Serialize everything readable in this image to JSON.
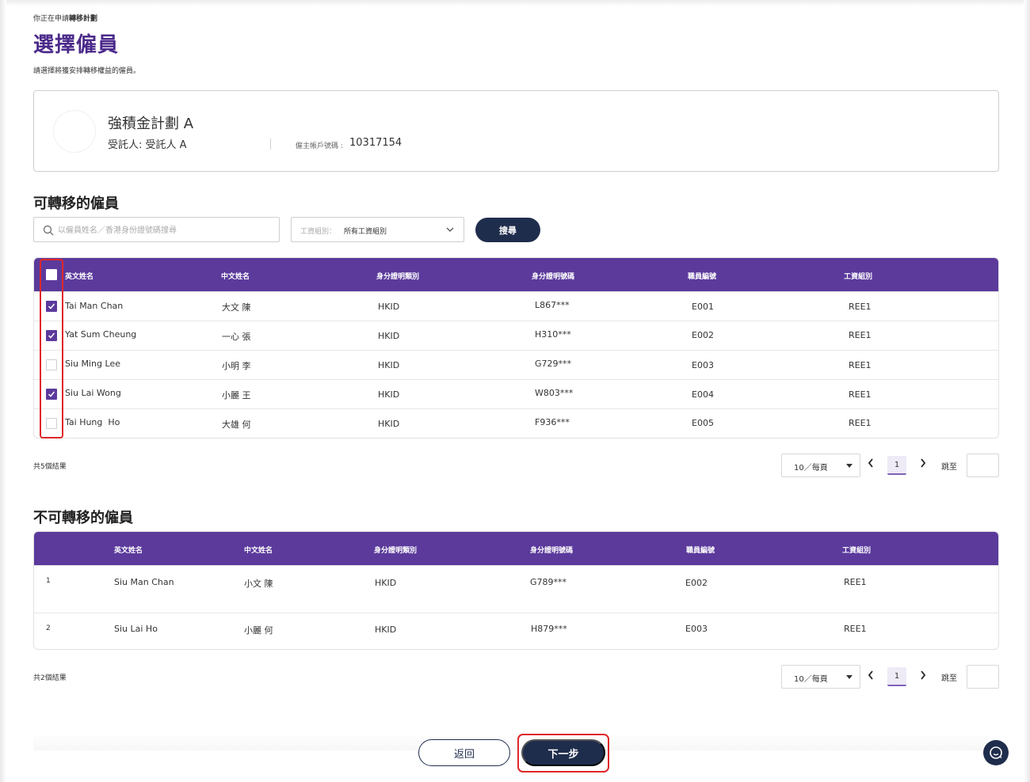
{
  "breadcrumb": {
    "prefix": "你正在申請",
    "highlight": "轉移計劃"
  },
  "page": {
    "title": "選擇僱員",
    "subtitle": "請選擇將獲安排轉移權益的僱員。"
  },
  "plan": {
    "name": "強積金計劃 A",
    "trustee": "受託人: 受託人 A",
    "account_label": "僱主帳戶號碼 :",
    "account_value": "10317154"
  },
  "transferable": {
    "section_title": "可轉移的僱員",
    "search_placeholder": "以僱員姓名／香港身份證號碼搜尋",
    "payroll_label": "工資組別：",
    "payroll_value": "所有工資組別",
    "search_button": "搜尋",
    "columns": [
      "英文姓名",
      "中文姓名",
      "身分證明類別",
      "身分證明號碼",
      "職員編號",
      "工資組別"
    ],
    "rows": [
      {
        "checked": true,
        "en": "Tai Man Chan",
        "zh": "大文 陳",
        "id_type": "HKID",
        "id_no": "L867***",
        "staff": "E001",
        "group": "REE1"
      },
      {
        "checked": true,
        "en": "Yat Sum Cheung",
        "zh": "一心 張",
        "id_type": "HKID",
        "id_no": "H310***",
        "staff": "E002",
        "group": "REE1"
      },
      {
        "checked": false,
        "en": "Siu Ming Lee",
        "zh": "小明 李",
        "id_type": "HKID",
        "id_no": "G729***",
        "staff": "E003",
        "group": "REE1"
      },
      {
        "checked": true,
        "en": "Siu Lai Wong",
        "zh": "小麗 王",
        "id_type": "HKID",
        "id_no": "W803***",
        "staff": "E004",
        "group": "REE1"
      },
      {
        "checked": false,
        "en": "Tai Hung  Ho",
        "zh": "大雄 何",
        "id_type": "HKID",
        "id_no": "F936***",
        "staff": "E005",
        "group": "REE1"
      }
    ],
    "result_count": "共5個結果",
    "pager": {
      "page_size": "10／每頁",
      "current_page": "1",
      "jump_label": "跳至"
    }
  },
  "non_transferable": {
    "section_title": "不可轉移的僱員",
    "columns": [
      "英文姓名",
      "中文姓名",
      "身分證明類別",
      "身分證明號碼",
      "職員編號",
      "工資組別"
    ],
    "rows": [
      {
        "index": "1",
        "en": "Siu Man Chan",
        "zh": "小文 陳",
        "id_type": "HKID",
        "id_no": "G789***",
        "staff": "E002",
        "group": "REE1"
      },
      {
        "index": "2",
        "en": "Siu Lai Ho",
        "zh": "小麗 何",
        "id_type": "HKID",
        "id_no": "H879***",
        "staff": "E003",
        "group": "REE1"
      }
    ],
    "result_count": "共2個結果",
    "pager": {
      "page_size": "10／每頁",
      "current_page": "1",
      "jump_label": "跳至"
    }
  },
  "actions": {
    "back": "返回",
    "next": "下一步"
  },
  "colors": {
    "primary": "#5b3a9c",
    "navy": "#1f2d4d",
    "highlight": "#e0262a"
  },
  "icons": [
    "search-icon",
    "chevron-down-icon",
    "check-icon",
    "chevron-left-icon",
    "chevron-right-icon",
    "chat-icon"
  ]
}
